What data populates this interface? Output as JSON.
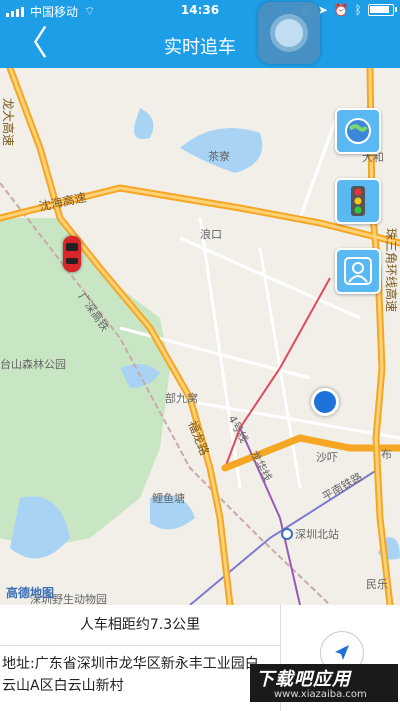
{
  "status_bar": {
    "carrier": "中国移动",
    "time": "14:36"
  },
  "nav": {
    "back_glyph": "〈",
    "title": "实时追车"
  },
  "map": {
    "labels": {
      "longda": "龙大高速",
      "yanhai": "沈海高速",
      "chaliao": "茶寮",
      "dahe": "大和",
      "langkou": "浪口",
      "zhusanjiao": "珠三角环线高速",
      "guangshen": "广深高铁",
      "forest": "台山森林公园",
      "bujiu": "部九窝",
      "fulong": "福龙路",
      "line4": "4号线",
      "longhua": "龙华线",
      "shahu": "沙吓",
      "buji": "布",
      "pingnan": "平南铁路",
      "liyutang": "鲤鱼塘",
      "shenzhenbei": "深圳北站",
      "zoo": "深圳野生动物园",
      "minle": "民乐"
    },
    "logo_text": "高德地图",
    "side_buttons": [
      "globe-icon",
      "traffic-light-icon",
      "person-icon"
    ]
  },
  "panel": {
    "distance": "人车相距约7.3公里",
    "address": "地址:广东省深圳市龙华区新永丰工业园白云山A区白云山新村"
  },
  "watermark": {
    "title": "下载吧应用",
    "url": "www.xiazaiba.com"
  },
  "colors": {
    "header": "#1f9ee8",
    "expressway": "#f5a623",
    "location": "#1e73d8",
    "car": "#d8252b"
  }
}
